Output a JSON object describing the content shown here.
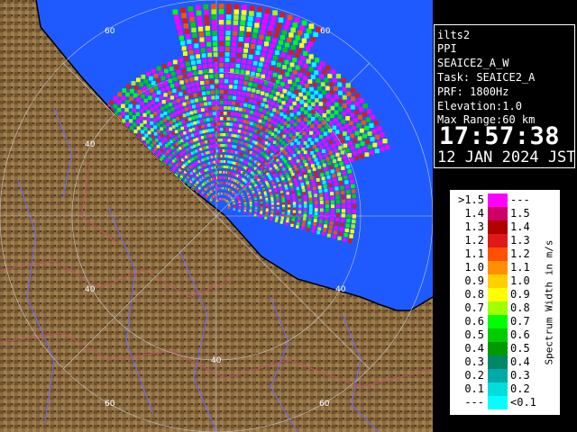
{
  "info": {
    "site": "ilts2",
    "product": "PPI",
    "scan_name": "SEAICE2_A_W",
    "task": "Task: SEAICE2_A",
    "prf": "PRF: 1800Hz",
    "elevation": "Elevation:1.0",
    "max_range": "Max Range:60 km",
    "time": "17:57:38",
    "date": "12 JAN 2024 JST"
  },
  "range_labels": [
    "60",
    "60",
    "40",
    "40",
    "40",
    "40",
    "60",
    "60"
  ],
  "legend": {
    "unit": "Spectrum Width in m/s",
    "rows": [
      {
        "left": ">1.5",
        "right": "---",
        "color": "#ff00ff"
      },
      {
        "left": "1.4",
        "right": "1.5",
        "color": "#cc0066"
      },
      {
        "left": "1.3",
        "right": "1.4",
        "color": "#b00000"
      },
      {
        "left": "1.2",
        "right": "1.3",
        "color": "#e01818"
      },
      {
        "left": "1.1",
        "right": "1.2",
        "color": "#ff5000"
      },
      {
        "left": "1.0",
        "right": "1.1",
        "color": "#ff9000"
      },
      {
        "left": "0.9",
        "right": "1.0",
        "color": "#ffd000"
      },
      {
        "left": "0.8",
        "right": "0.9",
        "color": "#ffff00"
      },
      {
        "left": "0.7",
        "right": "0.8",
        "color": "#a0ff00"
      },
      {
        "left": "0.6",
        "right": "0.7",
        "color": "#00ff00"
      },
      {
        "left": "0.5",
        "right": "0.6",
        "color": "#00cc00"
      },
      {
        "left": "0.4",
        "right": "0.5",
        "color": "#009900"
      },
      {
        "left": "0.3",
        "right": "0.4",
        "color": "#008866"
      },
      {
        "left": "0.2",
        "right": "0.3",
        "color": "#00aaaa"
      },
      {
        "left": "0.1",
        "right": "0.2",
        "color": "#00dddd"
      },
      {
        "left": "---",
        "right": "<0.1",
        "color": "#00ffff"
      }
    ]
  },
  "colors": {
    "sea": "#1e5aff",
    "land": "#8a6a3e",
    "land_dark": "#5a4226",
    "panel_bg": "#000000",
    "panel_fg": "#ffffff"
  }
}
